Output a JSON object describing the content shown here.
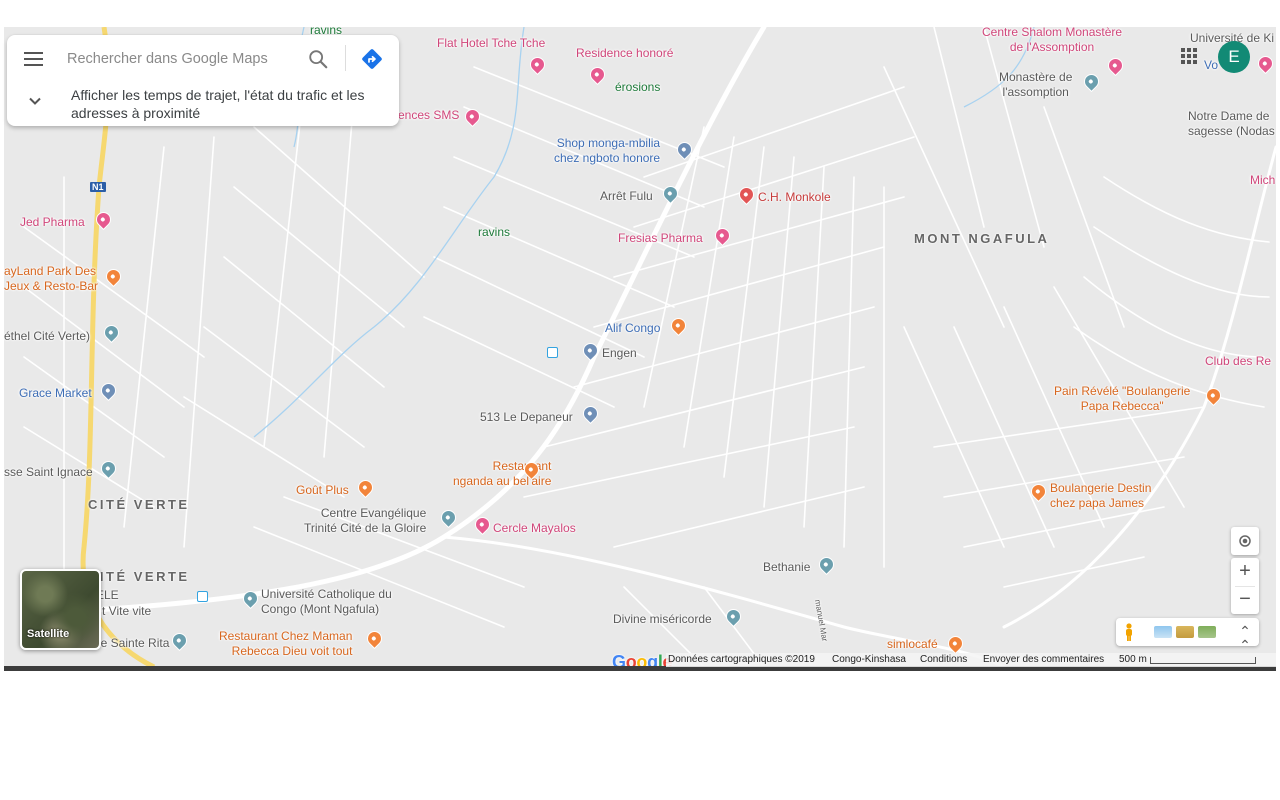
{
  "search": {
    "placeholder": "Rechercher dans Google Maps",
    "travel_info": "Afficher les temps de trajet, l'état du trafic et les adresses à proximité",
    "icons": {
      "menu": "menu-icon",
      "search": "search-icon",
      "directions": "directions-icon",
      "chevron": "chevron-down-icon"
    }
  },
  "account": {
    "initial": "E",
    "color": "#128a75"
  },
  "map": {
    "districts": [
      "MONT NGAFULA",
      "CITÉ VERTE",
      "CITÉ VERTE"
    ],
    "places": [
      "Flat Hotel Tche Tche",
      "Residence honoré",
      "érosions",
      "ravins",
      "ences SMS",
      "Shop monga-mbilia\nchez ngboto honore",
      "Arrêt Fulu",
      "C.H. Monkole",
      "Fresias Pharma",
      "ravins",
      "Jed Pharma",
      "ayLand Park Des\nJeux & Resto-Bar",
      "éthel Cité Verte)",
      "Alif Congo",
      "Engen",
      "Grace Market",
      "513 Le Depaneur",
      "sse Saint Ignace",
      "Restaurant\nnganda au bel'aire",
      "Goût Plus",
      "Centre Evangélique\nTrinité Cité de la Gloire",
      "Cercle Mayalos",
      "Université Catholique du\nCongo (Mont Ngafula)",
      "Restaurant Chez Maman\nRebecca Dieu voit tout",
      "Divine miséricorde",
      "Bethanie",
      "Centre Shalom Monastère\nde l'Assomption",
      "Monastère de\nl'assomption",
      "Université de Ki",
      "Vo",
      "Notre Dame de\nsagesse (Nodas",
      "Mich",
      "Club des Re",
      "Pain Révélé \"Boulangerie\nPapa Rebecca\"",
      "Boulangerie Destin\nchez papa James",
      "simlocafé",
      "ELE",
      "t Vite vite",
      "de Sainte Rita"
    ],
    "road_shield": "N1",
    "street_label": "manuel Mar"
  },
  "controls": {
    "satellite_label": "Satellite",
    "zoom_in": "+",
    "zoom_out": "−"
  },
  "logo": {
    "text": "Google"
  },
  "attribution": {
    "data": "Données cartographiques ©2019",
    "region": "Congo-Kinshasa",
    "terms": "Conditions",
    "feedback": "Envoyer des commentaires",
    "scale": "500 m"
  }
}
